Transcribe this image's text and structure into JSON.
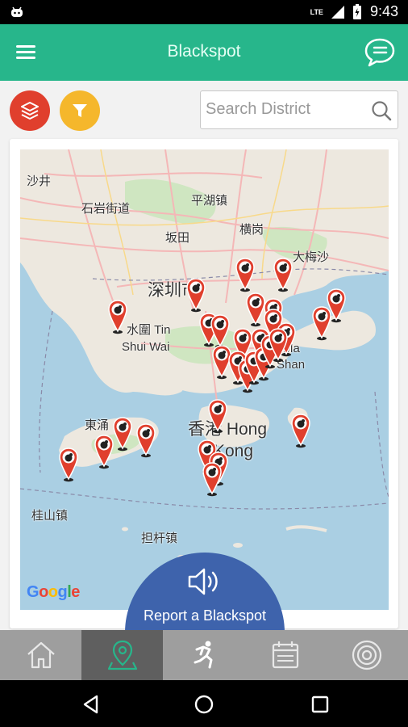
{
  "status_bar": {
    "network": "LTE",
    "time": "9:43"
  },
  "app_bar": {
    "title": "Blackspot"
  },
  "search": {
    "placeholder": "Search District"
  },
  "map": {
    "labels": [
      {
        "text": "沙井"
      },
      {
        "text": "石岩街道"
      },
      {
        "text": "平湖镇"
      },
      {
        "text": "横岗"
      },
      {
        "text": "坂田"
      },
      {
        "text": "大梅沙"
      },
      {
        "text": "深圳市"
      },
      {
        "text": "水圍 Tin"
      },
      {
        "text": "Shui Wai"
      },
      {
        "text": "馬鞍"
      },
      {
        "text": "Ma"
      },
      {
        "text": "Shan"
      },
      {
        "text": "東涌"
      },
      {
        "text": "香港 Hong"
      },
      {
        "text": "Kong"
      },
      {
        "text": "桂山镇"
      },
      {
        "text": "担杆镇"
      }
    ],
    "attribution": "Google",
    "blackspot_count": 30
  },
  "report_button": {
    "label": "Report a Blackspot",
    "icon": "speaker-icon"
  },
  "bottom_nav": {
    "tabs": [
      {
        "name": "home",
        "icon": "home-icon",
        "active": false
      },
      {
        "name": "map",
        "icon": "map-pin-icon",
        "active": true
      },
      {
        "name": "activity",
        "icon": "runner-icon",
        "active": false
      },
      {
        "name": "calendar",
        "icon": "calendar-icon",
        "active": false
      },
      {
        "name": "target",
        "icon": "target-icon",
        "active": false
      }
    ]
  },
  "colors": {
    "primary": "#27b68b",
    "pin": "#e03f2d",
    "filter": "#f5b72c",
    "report": "#3e63ac"
  }
}
